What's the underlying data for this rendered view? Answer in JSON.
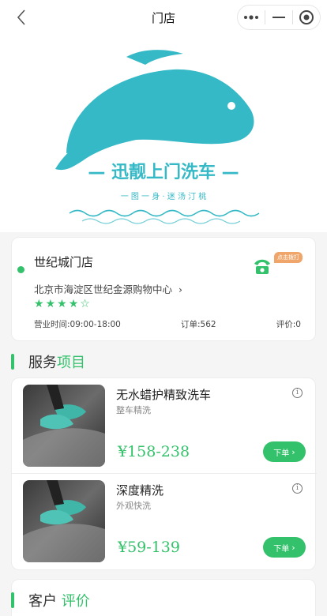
{
  "nav": {
    "title": "门店",
    "back_icon": "chevron-left-icon",
    "more_icon": "more-dots-icon",
    "minimize_icon": "minimize-icon",
    "close_icon": "target-circle-icon"
  },
  "hero": {
    "brand_name": "— 迅靓上门洗车 —",
    "tagline": "一 图 一 身 · 迷 汤 汀 桃",
    "logo_icon": "whale-logo-icon"
  },
  "store": {
    "name": "世纪城门店",
    "address": "北京市海淀区世纪金源购物中心",
    "rating_stars": 4,
    "rating_max": 5,
    "hours": "营业时间:09:00-18:00",
    "orders": "订单:562",
    "reviews": "评价:0",
    "call_badge": "点击拨打",
    "phone_icon": "phone-icon"
  },
  "services_section": {
    "title_plain": "服务",
    "title_accent": "项目"
  },
  "services": [
    {
      "name": "无水蜡护精致洗车",
      "subtitle": "整车精洗",
      "price": "¥158-238",
      "order_label": "下单"
    },
    {
      "name": "深度精洗",
      "subtitle": "外观快洗",
      "price": "¥59-139",
      "order_label": "下单"
    }
  ],
  "reviews_section": {
    "title_plain": "客户",
    "title_accent": "评价"
  },
  "colors": {
    "accent": "#34c16b",
    "logo": "#35b9c6",
    "badge": "#f0a56a"
  }
}
